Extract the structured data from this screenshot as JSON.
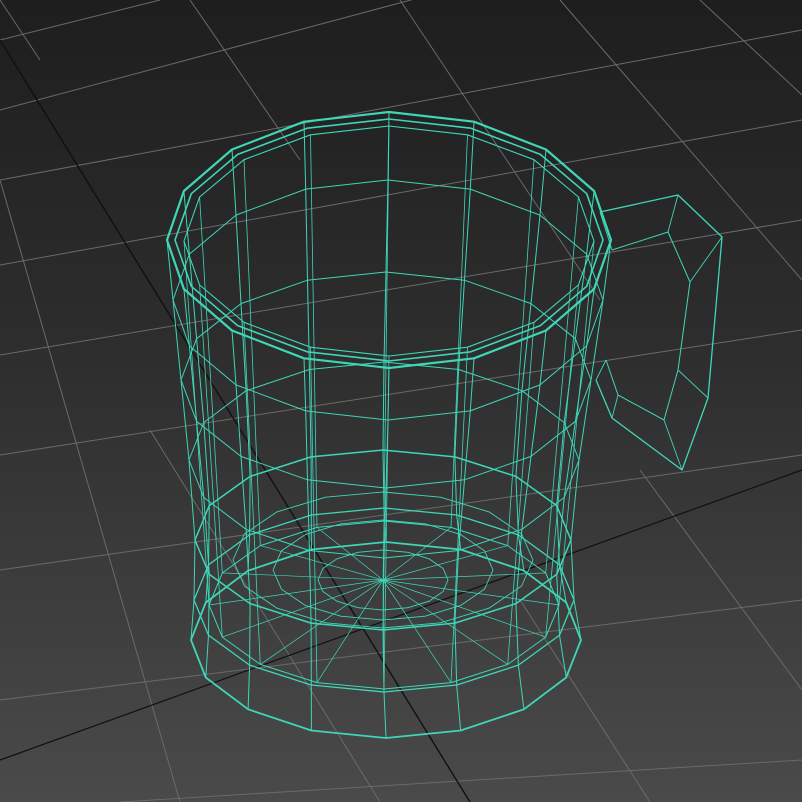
{
  "viewport": {
    "view": "perspective",
    "shading": "wireframe",
    "grid_visible": true,
    "colors": {
      "background_top": "#1e1e1e",
      "background_bottom": "#4a4a4a",
      "grid_line": "#6a6a6a",
      "grid_axis": "#101010",
      "wireframe": "#3fd6b8"
    }
  },
  "object": {
    "type": "mug",
    "display": "wireframe",
    "has_handle": true
  }
}
